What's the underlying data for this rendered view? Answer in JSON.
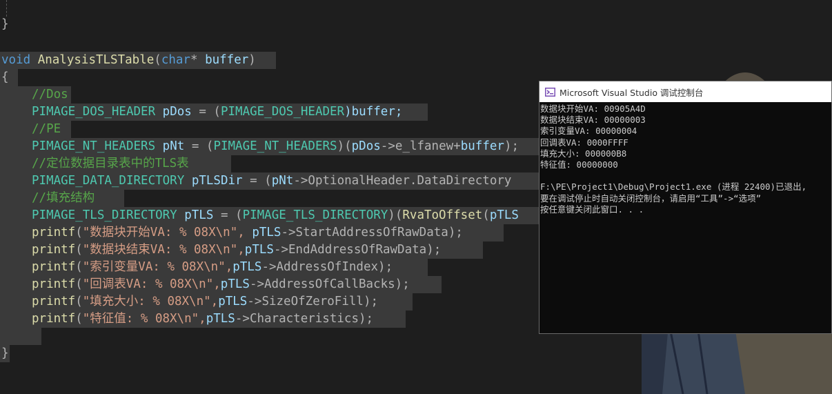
{
  "editor": {
    "brace_top_close": "}",
    "func_void": "void",
    "func_name": "AnalysisTLSTable",
    "func_paren_open": "(",
    "func_char": "char",
    "func_star": "*",
    "func_param": " buffer",
    "func_paren_close": ")",
    "brace_open": "{",
    "cm_dos": "//Dos",
    "l_dos_type": "PIMAGE_DOS_HEADER",
    "l_dos_var": "pDos",
    "l_dos_eq": " = (",
    "l_dos_cast": "PIMAGE_DOS_HEADER",
    "l_dos_rest": ")buffer;",
    "cm_pe": "//PE",
    "l_nt_type": "PIMAGE_NT_HEADERS",
    "l_nt_var": "pNt",
    "l_nt_eq": " = (",
    "l_nt_cast": "PIMAGE_NT_HEADERS",
    "l_nt_p1": ")(",
    "l_nt_pdos": "pDos",
    "l_nt_arrow": "->",
    "l_nt_field": "e_lfanew",
    "l_nt_plus": "+",
    "l_nt_buf": "buffer",
    "l_nt_end": ");",
    "cm_dir": "//定位数据目录表中的TLS表",
    "l_dir_type": "PIMAGE_DATA_DIRECTORY",
    "l_dir_var": "pTLSDir",
    "l_dir_eq": " = (",
    "l_dir_pnt": "pNt",
    "l_dir_arrow": "->",
    "l_dir_field": "OptionalHeader.DataDirectory",
    "cm_fill": "//填充结构",
    "l_tls_type": "PIMAGE_TLS_DIRECTORY",
    "l_tls_var": "pTLS",
    "l_tls_eq": " = (",
    "l_tls_cast": "PIMAGE_TLS_DIRECTORY",
    "l_tls_p1": ")(",
    "l_tls_fn": "RvaToOffset",
    "l_tls_p2": "(",
    "l_tls_arg": "pTLS",
    "printf_lines": [
      {
        "fn": "printf",
        "str": "\"数据块开始VA: % 08X\\n\", ",
        "var": "pTLS",
        "arrow": "->",
        "field": "StartAddressOfRawData",
        "end": ");"
      },
      {
        "fn": "printf",
        "str": "\"数据块结束VA: % 08X\\n\",",
        "var": "pTLS",
        "arrow": "->",
        "field": "EndAddressOfRawData",
        "end": ");"
      },
      {
        "fn": "printf",
        "str": "\"索引变量VA: % 08X\\n\",",
        "var": "pTLS",
        "arrow": "->",
        "field": "AddressOfIndex",
        "end": ");"
      },
      {
        "fn": "printf",
        "str": "\"回调表VA: % 08X\\n\",",
        "var": "pTLS",
        "arrow": "->",
        "field": "AddressOfCallBacks",
        "end": ");"
      },
      {
        "fn": "printf",
        "str": "\"填充大小: % 08X\\n\",",
        "var": "pTLS",
        "arrow": "->",
        "field": "SizeOfZeroFill",
        "end": ");"
      },
      {
        "fn": "printf",
        "str": "\"特征值: % 08X\\n\",",
        "var": "pTLS",
        "arrow": "->",
        "field": "Characteristics",
        "end": ");"
      }
    ],
    "brace_close": "}"
  },
  "console": {
    "title": "Microsoft Visual Studio 调试控制台",
    "icon": "visual-studio-icon",
    "lines": [
      "数据块开始VA: 00905A4D",
      "数据块结束VA: 00000003",
      "索引变量VA: 00000004",
      "回调表VA: 0000FFFF",
      "填充大小: 000000B8",
      "特征值: 00000000",
      "",
      "F:\\PE\\Project1\\Debug\\Project1.exe (进程 22400)已退出,",
      "要在调试停止时自动关闭控制台，请启用“工具”->“选项”",
      "按任意键关闭此窗口. . ."
    ]
  },
  "colors": {
    "editor_bg": "#1e1e1e",
    "selection": "#3a3a3a",
    "keyword": "#569cd6",
    "type": "#4ec9b0",
    "function": "#dcdcaa",
    "variable": "#9cdcfe",
    "string": "#d69d85",
    "comment": "#57a64a",
    "console_bg": "#0c0c0c"
  }
}
